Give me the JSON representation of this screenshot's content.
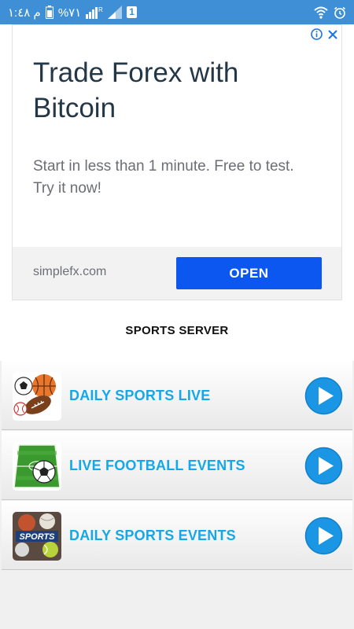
{
  "status_bar": {
    "clock": "م ١:٤٨",
    "battery": "%٧١",
    "sim_slot": "1",
    "signal_tag": "R",
    "color": "#3f8fd6"
  },
  "ad": {
    "headline": "Trade Forex with Bitcoin",
    "body": "Start in less than 1 minute. Free to test. Try it now!",
    "domain": "simplefx.com",
    "cta_label": "OPEN",
    "cta_color": "#0b57f0",
    "info_icon": "info-icon",
    "close_icon": "close-icon"
  },
  "section_title": "SPORTS SERVER",
  "servers": [
    {
      "label": "DAILY SPORTS LIVE",
      "icon": "sports-balls-icon"
    },
    {
      "label": "LIVE FOOTBALL EVENTS",
      "icon": "football-field-icon"
    },
    {
      "label": "DAILY SPORTS EVENTS",
      "icon": "sports-logo-icon"
    }
  ],
  "accent_color": "#14a8e8"
}
